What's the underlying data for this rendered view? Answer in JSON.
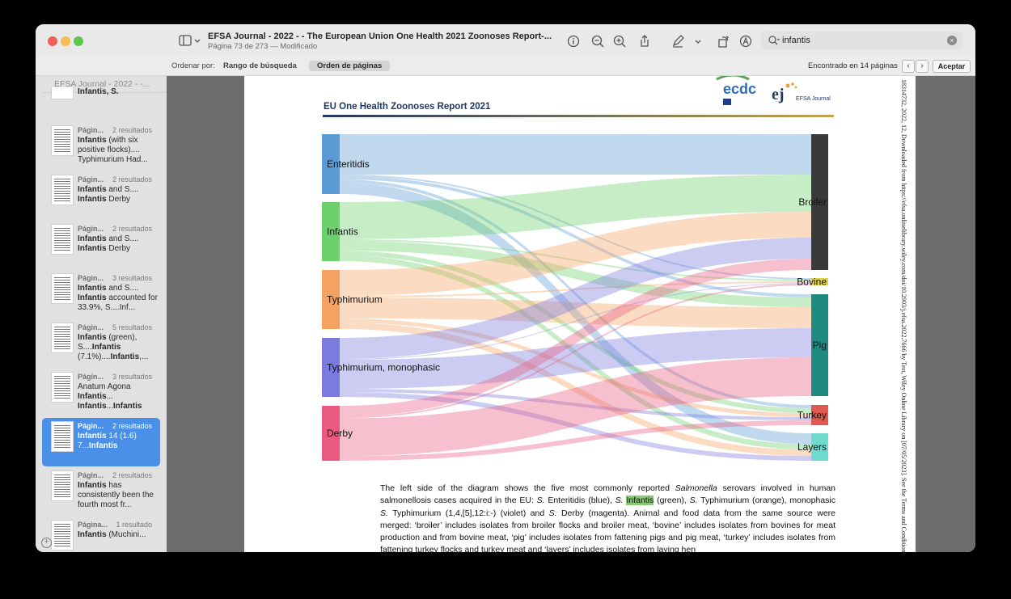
{
  "window": {
    "title": "EFSA Journal - 2022 -  - The European Union One Health 2021 Zoonoses Report-...",
    "subtitle": "Página 73 de 273 — Modificado"
  },
  "search": {
    "value": "infantis"
  },
  "findbar": {
    "order_label": "Ordenar por:",
    "rank_option": "Rango de búsqueda",
    "page_option": "Orden de páginas",
    "found_text": "Encontrado en 14 páginas",
    "prev": "‹",
    "next": "›",
    "accept": "Aceptar"
  },
  "sidebar": {
    "header": "EFSA Journal - 2022 -  -...",
    "partial_top": "Infantis, S.",
    "results": [
      {
        "page": "Págin...",
        "count": "2 resultados",
        "snippet": "Infantis (with six positive flocks)....\nTyphimurium Had..."
      },
      {
        "page": "Págin...",
        "count": "2 resultados",
        "snippet": "Infantis and S....\nInfantis Derby"
      },
      {
        "page": "Págin...",
        "count": "2 resultados",
        "snippet": "Infantis and S....\nInfantis Derby"
      },
      {
        "page": "Págin...",
        "count": "3 resultados",
        "snippet": "Infantis and S....\nInfantis accounted for 33.9%, S....Inf..."
      },
      {
        "page": "Págin...",
        "count": "5 resultados",
        "snippet": "Infantis (green), S....Infantis (7.1%)....Infantis,..."
      },
      {
        "page": "Págin...",
        "count": "3 resultados",
        "snippet": "Anatum Agona Infantis...\nInfantis...Infantis"
      },
      {
        "page": "Págin...",
        "count": "2 resultados",
        "snippet": "Infantis 14 (1.6)\n7...Infantis",
        "selected": true
      },
      {
        "page": "Págin...",
        "count": "2 resultados",
        "snippet": "Infantis has consistently been the fourth most fr..."
      },
      {
        "page": "Página...",
        "count": "1 resultado",
        "snippet": "Infantis (Muchini..."
      }
    ]
  },
  "document": {
    "report_title": "EU One Health Zoonoses Report 2021",
    "logo_ecdc": "ecdc",
    "logo_ej": "ej",
    "logo_ej_text": "EFSA Journal",
    "caption": {
      "t1": "The left side of the diagram shows the five most commonly reported ",
      "t2": "Salmonella",
      "t3": " serovars involved in human salmonellosis cases acquired in the EU: ",
      "t4": "S.",
      "t5": " Enteritidis (blue), ",
      "t6": "S.",
      "t7": "Infantis",
      "t8": " (green), ",
      "t9": "S.",
      "t10": " Typhimurium (orange), monophasic ",
      "t11": "S.",
      "t12": " Typhimurium (1,4,[5],12:i:-) (violet) and ",
      "t13": "S.",
      "t14": " Derby (magenta). Animal and food data from the same source were merged: ‘broiler’ includes isolates from broiler flocks and broiler meat, ‘bovine’ includes isolates from bovines for meat production and from bovine meat, ‘pig’ includes isolates from fattening pigs and pig meat, ‘turkey’ includes isolates from fattening turkey flocks and turkey meat and ‘layers’ includes isolates from laying hen"
    },
    "side_note": "18314732, 2022, 12, Downloaded from https://efsa.onlinelibrary.wiley.com/doi/10.2903/j.efsa.2022.7666 by Test, Wiley Online Library on [07/05/2023]. See the Terms and Conditions"
  },
  "chart_data": {
    "type": "sankey",
    "sources": [
      "Enteritidis",
      "Infantis",
      "Typhimurium",
      "Typhimurium, monophasic",
      "Derby"
    ],
    "targets": [
      "Broiler",
      "Bovine",
      "Pig",
      "Turkey",
      "Layers"
    ],
    "colors": {
      "Enteritidis": "#5b9bd5",
      "Infantis": "#6cd06c",
      "Typhimurium": "#f4a261",
      "Typhimurium, monophasic": "#7a7adf",
      "Derby": "#ea5a7f",
      "Broiler": "#3a3a3a",
      "Bovine": "#e3d24a",
      "Pig": "#1f8a80",
      "Turkey": "#e05a4f",
      "Layers": "#6fdccf"
    }
  }
}
